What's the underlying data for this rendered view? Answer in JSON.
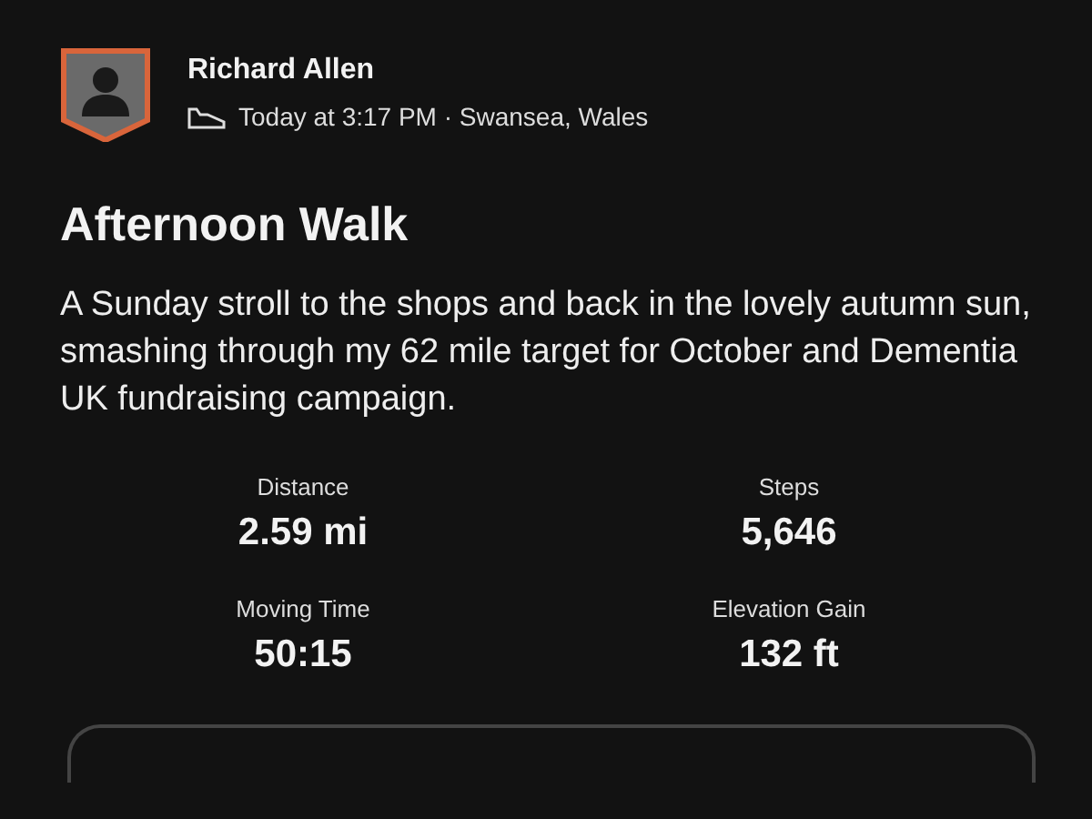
{
  "athlete": {
    "name": "Richard Allen",
    "meta": "Today at 3:17 PM · Swansea, Wales"
  },
  "activity": {
    "title": "Afternoon Walk",
    "description": "A Sunday stroll to the shops and back in the lovely autumn sun, smashing through my 62 mile target for October and Dementia UK fundraising campaign."
  },
  "stats": [
    {
      "label": "Distance",
      "value": "2.59 mi"
    },
    {
      "label": "Steps",
      "value": "5,646"
    },
    {
      "label": "Moving Time",
      "value": "50:15"
    },
    {
      "label": "Elevation Gain",
      "value": "132 ft"
    }
  ]
}
